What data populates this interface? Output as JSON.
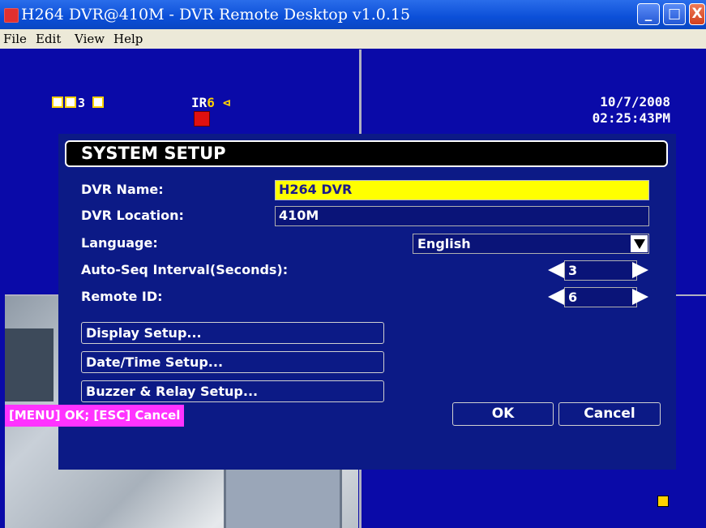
{
  "window": {
    "title": "H264 DVR@410M - DVR Remote Desktop v1.0.15",
    "buttons": {
      "minimize": "_",
      "maximize": "□",
      "close": "X"
    }
  },
  "menubar": {
    "items": [
      "File",
      "Edit",
      "View",
      "Help"
    ]
  },
  "osd": {
    "camera_label": "3",
    "ir_label": "IR",
    "ir_value": "6",
    "speaker": "⊲",
    "date": "10/7/2008",
    "time": "02:25:43PM"
  },
  "dialog": {
    "title": "SYSTEM SETUP",
    "dvr_name_label": "DVR Name:",
    "dvr_name_value": "H264 DVR",
    "dvr_location_label": "DVR Location:",
    "dvr_location_value": "410M",
    "language_label": "Language:",
    "language_value": "English",
    "autoseq_label": "Auto-Seq Interval(Seconds):",
    "autoseq_value": "3",
    "remote_id_label": "Remote ID:",
    "remote_id_value": "6",
    "display_setup": "Display Setup...",
    "datetime_setup": "Date/Time Setup...",
    "buzzer_setup": "Buzzer & Relay Setup...",
    "hint": "[MENU] OK; [ESC] Cancel",
    "ok": "OK",
    "cancel": "Cancel"
  },
  "colors": {
    "background": "#0a0aa8",
    "highlight": "#ffff00",
    "hint_bg": "#ff33ff"
  }
}
